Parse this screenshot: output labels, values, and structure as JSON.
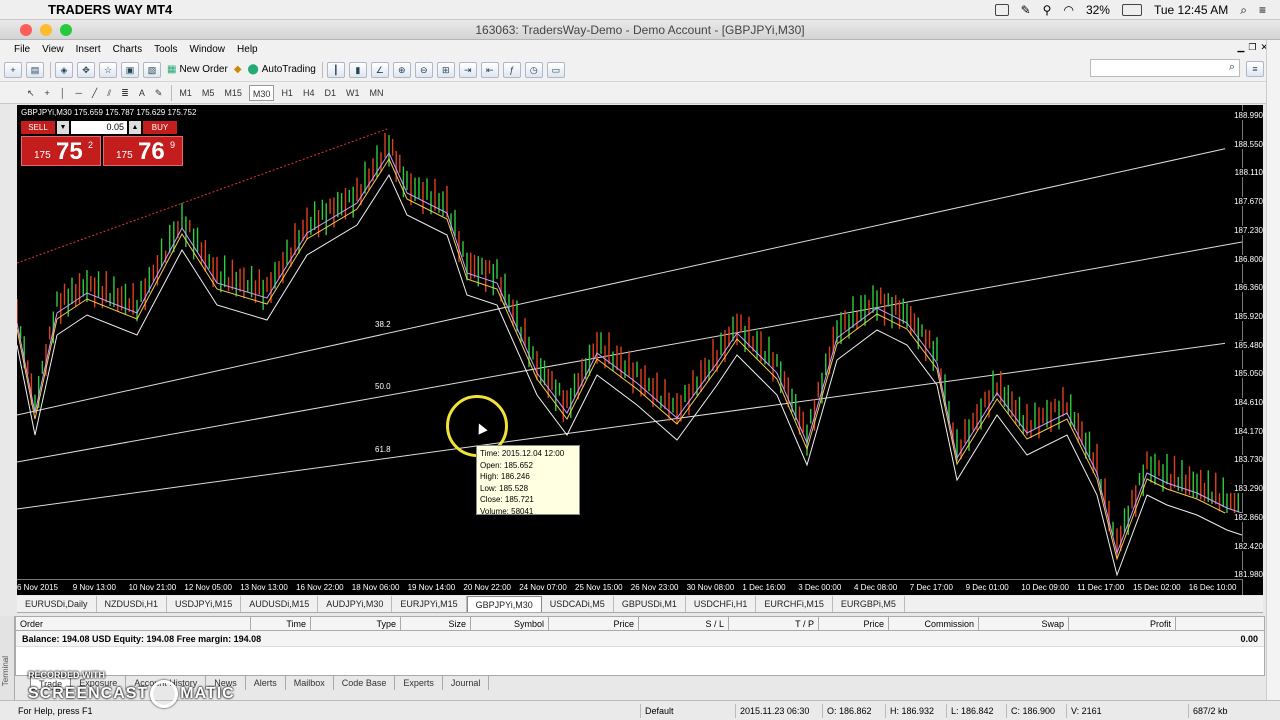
{
  "macbar": {
    "app_name": "TRADERS WAY MT4",
    "battery": "32%",
    "clock": "Tue 12:45 AM"
  },
  "window": {
    "title": "163063: TradersWay-Demo - Demo Account - [GBPJPYi,M30]"
  },
  "menu": [
    "File",
    "View",
    "Insert",
    "Charts",
    "Tools",
    "Window",
    "Help"
  ],
  "toolbar": {
    "new_order": "New Order",
    "autotrading": "AutoTrading"
  },
  "timeframes": [
    "M1",
    "M5",
    "M15",
    "M30",
    "H1",
    "H4",
    "D1",
    "W1",
    "MN"
  ],
  "active_timeframe": "M30",
  "chart": {
    "header": "GBPJPYi,M30  175.659 175.787 175.629 175.752",
    "sell_label": "SELL",
    "buy_label": "BUY",
    "lot": "0.05",
    "sell_small": "175",
    "sell_big": "75",
    "sell_sup": "2",
    "buy_small": "175",
    "buy_big": "76",
    "buy_sup": "9",
    "fib": [
      "38.2",
      "50.0",
      "61.8"
    ],
    "price_labels": [
      "188.990",
      "188.550",
      "188.110",
      "187.670",
      "187.230",
      "186.800",
      "186.360",
      "185.920",
      "185.480",
      "185.050",
      "184.610",
      "184.170",
      "183.730",
      "183.290",
      "182.860",
      "182.420",
      "181.980"
    ],
    "time_labels": [
      "6 Nov 2015",
      "9 Nov 13:00",
      "10 Nov 21:00",
      "12 Nov 05:00",
      "13 Nov 13:00",
      "16 Nov 22:00",
      "18 Nov 06:00",
      "19 Nov 14:00",
      "20 Nov 22:00",
      "24 Nov 07:00",
      "25 Nov 15:00",
      "26 Nov 23:00",
      "30 Nov 08:00",
      "1 Dec 16:00",
      "3 Dec 00:00",
      "4 Dec 08:00",
      "7 Dec 17:00",
      "9 Dec 01:00",
      "10 Dec 09:00",
      "11 Dec 17:00",
      "15 Dec 02:00",
      "16 Dec 10:00"
    ],
    "tooltip": {
      "time": "Time: 2015.12.04 12:00",
      "open": "Open: 185.652",
      "high": "High: 186.246",
      "low": "Low: 185.528",
      "close": "Close: 185.721",
      "volume": "Volume: 58041"
    }
  },
  "chart_tabs": [
    "EURUSDi,Daily",
    "NZDUSDi,H1",
    "USDJPYi,M15",
    "AUDUSDi,M15",
    "AUDJPYi,M30",
    "EURJPYi,M15",
    "GBPJPYi,M30",
    "USDCADi,M5",
    "GBPUSDi,M1",
    "USDCHFi,H1",
    "EURCHFi,M15",
    "EURGBPi,M5"
  ],
  "active_chart_tab": "GBPJPYi,M30",
  "terminal": {
    "columns": [
      "Order",
      "Time",
      "Type",
      "Size",
      "Symbol",
      "Price",
      "S / L",
      "T / P",
      "Price",
      "Commission",
      "Swap",
      "Profit"
    ],
    "balance_row": "Balance: 194.08 USD  Equity: 194.08  Free margin: 194.08",
    "profit": "0.00",
    "tabs": [
      "Trade",
      "Exposure",
      "Account History",
      "News",
      "Alerts",
      "Mailbox",
      "Code Base",
      "Experts",
      "Journal"
    ],
    "side_label": "Terminal"
  },
  "status": {
    "help": "For Help, press F1",
    "profile": "Default",
    "time": "2015.11.23 06:30",
    "open": "O: 186.862",
    "high": "H: 186.932",
    "low": "L: 186.842",
    "close": "C: 186.900",
    "volume": "V: 2161",
    "traffic": "687/2 kb"
  },
  "watermark": {
    "recorded": "RECORDED WITH",
    "brand_a": "SCREENCAST",
    "brand_b": "MATIC"
  }
}
